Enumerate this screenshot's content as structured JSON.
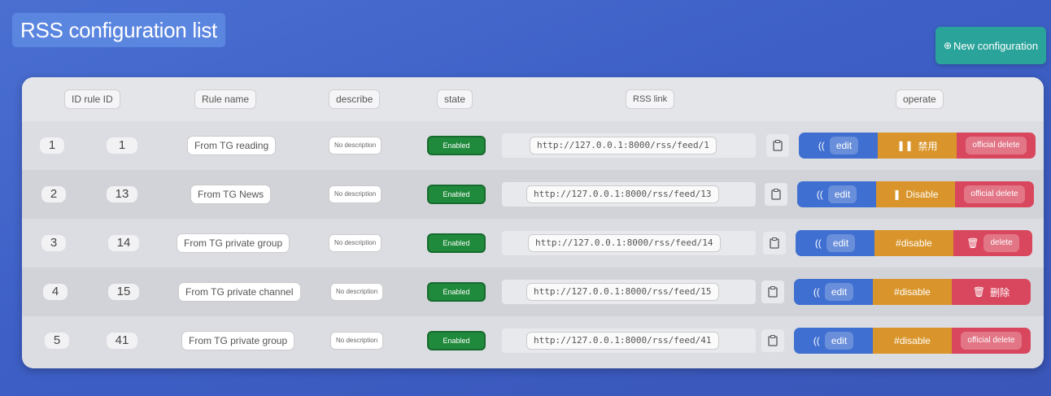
{
  "header": {
    "title": "RSS configuration list",
    "new_button": "New configuration",
    "new_icon": "⊕"
  },
  "table": {
    "columns": [
      "ID rule ID",
      "Rule name",
      "describe",
      "state",
      "RSS link",
      "operate"
    ],
    "rows": [
      {
        "index": "1",
        "rule_id": "1",
        "name": "From TG reading",
        "describe": "No description",
        "state": "Enabled",
        "link": "http://127.0.0.1:8000/rss/feed/1",
        "edit": "edit",
        "disable": "禁用",
        "delete": "official delete"
      },
      {
        "index": "2",
        "rule_id": "13",
        "name": "From TG News",
        "describe": "No description",
        "state": "Enabled",
        "link": "http://127.0.0.1:8000/rss/feed/13",
        "edit": "edit",
        "disable": "Disable",
        "delete": "official delete"
      },
      {
        "index": "3",
        "rule_id": "14",
        "name": "From TG private group",
        "describe": "No description",
        "state": "Enabled",
        "link": "http://127.0.0.1:8000/rss/feed/14",
        "edit": "edit",
        "disable": "#disable",
        "delete": "delete"
      },
      {
        "index": "4",
        "rule_id": "15",
        "name": "From TG private channel",
        "describe": "No description",
        "state": "Enabled",
        "link": "http://127.0.0.1:8000/rss/feed/15",
        "edit": "edit",
        "disable": "#disable",
        "delete": "删除"
      },
      {
        "index": "5",
        "rule_id": "41",
        "name": "From TG private group",
        "describe": "No description",
        "state": "Enabled",
        "link": "http://127.0.0.1:8000/rss/feed/41",
        "edit": "edit",
        "disable": "#disable",
        "delete": "official delete"
      }
    ]
  },
  "colors": {
    "edit": "#3f6fd0",
    "disable": "#d9952b",
    "delete": "#d9475e",
    "state": "#1f8a3c",
    "new_button": "#2aa39a"
  }
}
